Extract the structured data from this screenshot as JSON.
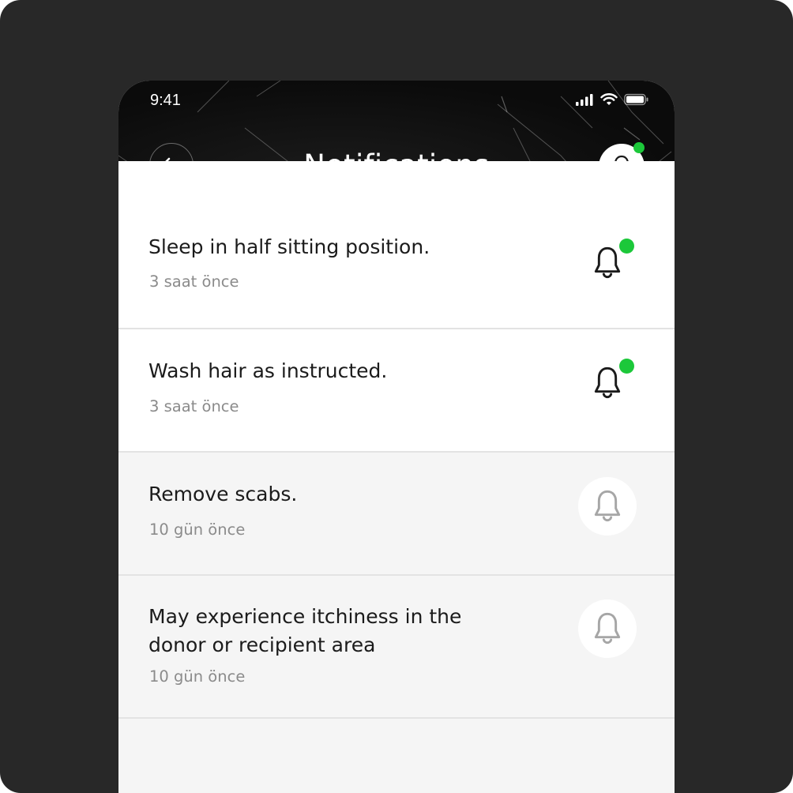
{
  "status_bar": {
    "time": "9:41"
  },
  "header": {
    "title": "Notifications",
    "back_icon": "arrow-left-icon",
    "bell_icon": "bell-icon",
    "has_unread": true
  },
  "notifications": [
    {
      "title": "Sleep in half sitting position.",
      "time": "3 saat önce",
      "unread": true
    },
    {
      "title": "Wash hair as instructed.",
      "time": "3 saat önce",
      "unread": true
    },
    {
      "title": "Remove scabs.",
      "time": "10 gün önce",
      "unread": false
    },
    {
      "title": "May experience itchiness in the donor or recipient area",
      "time": "10 gün önce",
      "unread": false
    }
  ],
  "colors": {
    "background": "#282828",
    "unread_dot": "#1cc83a",
    "text_primary": "#1b1b1b",
    "text_secondary": "#8b8b8b",
    "read_background": "#f5f5f5",
    "unread_background": "#ffffff"
  }
}
